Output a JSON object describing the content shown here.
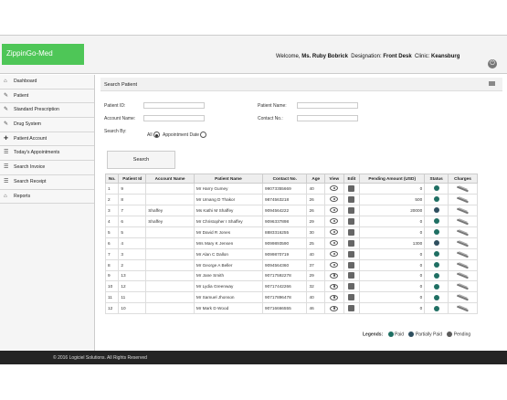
{
  "header": {
    "logo": "ZippinGo-Med",
    "welcome_label": "Welcome,",
    "user_name": "Ms. Ruby Bobrick",
    "designation_label": "Designation:",
    "designation": "Front Desk",
    "clinic_label": "Clinic:",
    "clinic": "Keansburg",
    "logout_icon": "power-icon"
  },
  "sidebar": {
    "items": [
      {
        "label": "Dashboard",
        "icon": "home-icon"
      },
      {
        "label": "Patient",
        "icon": "edit-icon"
      },
      {
        "label": "Standard Prescription",
        "icon": "edit-icon"
      },
      {
        "label": "Drug System",
        "icon": "edit-icon"
      },
      {
        "label": "Patient Account",
        "icon": "user-plus-icon"
      },
      {
        "label": "Today's Appointments",
        "icon": "list-icon"
      },
      {
        "label": "Search Invoice",
        "icon": "list-icon"
      },
      {
        "label": "Search Receipt",
        "icon": "list-icon"
      },
      {
        "label": "Reports",
        "icon": "home-icon"
      }
    ]
  },
  "search": {
    "panel_title": "Search Patient",
    "patient_id_label": "Patient ID:",
    "patient_id_value": "",
    "patient_name_label": "Patient Name:",
    "patient_name_value": "",
    "account_name_label": "Account Name:",
    "account_name_value": "",
    "contact_no_label": "Contact No.:",
    "contact_no_value": "",
    "search_by_label": "Search By:",
    "option_all": "All",
    "option_appointment": "Appointment Date",
    "selected": "All",
    "search_button": "Search"
  },
  "table": {
    "headers": [
      "No.",
      "Patient Id",
      "Account Name",
      "Patient Name",
      "Contact No.",
      "Age",
      "View",
      "Edit",
      "Pending Amount (USD)",
      "Status",
      "Charges"
    ],
    "rows": [
      {
        "no": "1",
        "pid": "9",
        "account": "",
        "name": "Mr Harry Gumey",
        "contact": "99073355669",
        "age": "40",
        "pending": "0",
        "status": "paid"
      },
      {
        "no": "2",
        "pid": "8",
        "account": "",
        "name": "Mr Umang D Thakor",
        "contact": "9874563218",
        "age": "26",
        "pending": "500",
        "status": "paid"
      },
      {
        "no": "3",
        "pid": "7",
        "account": "Shaffey",
        "name": "Ms Kathi M Shaffey",
        "contact": "9094564222",
        "age": "26",
        "pending": "20000",
        "status": "partially_paid"
      },
      {
        "no": "4",
        "pid": "6",
        "account": "Shaffey",
        "name": "Mr Christopher I Shaffey",
        "contact": "9096337898",
        "age": "29",
        "pending": "0",
        "status": "paid"
      },
      {
        "no": "5",
        "pid": "5",
        "account": "",
        "name": "Mr David R Jones",
        "contact": "8883316255",
        "age": "30",
        "pending": "0",
        "status": "paid"
      },
      {
        "no": "6",
        "pid": "4",
        "account": "",
        "name": "Mrs Mary K Jensen",
        "contact": "9099893590",
        "age": "25",
        "pending": "1300",
        "status": "partially_paid"
      },
      {
        "no": "7",
        "pid": "3",
        "account": "",
        "name": "Mr Alan C Dallon",
        "contact": "9099870719",
        "age": "40",
        "pending": "0",
        "status": "paid"
      },
      {
        "no": "8",
        "pid": "2",
        "account": "",
        "name": "Mr George A Beller",
        "contact": "9094564360",
        "age": "37",
        "pending": "0",
        "status": "paid"
      },
      {
        "no": "9",
        "pid": "13",
        "account": "",
        "name": "Mr Jane Smith",
        "contact": "90717592278",
        "age": "29",
        "pending": "0",
        "status": "paid"
      },
      {
        "no": "10",
        "pid": "12",
        "account": "",
        "name": "Mr Lydia Greenway",
        "contact": "90717442266",
        "age": "32",
        "pending": "0",
        "status": "paid"
      },
      {
        "no": "11",
        "pid": "11",
        "account": "",
        "name": "Mr Samuel Jhonson",
        "contact": "90717896478",
        "age": "40",
        "pending": "0",
        "status": "paid"
      },
      {
        "no": "12",
        "pid": "10",
        "account": "",
        "name": "Mr Mark D Wood",
        "contact": "90716666555",
        "age": "46",
        "pending": "0",
        "status": "paid"
      }
    ]
  },
  "legend": {
    "title": "Legends:",
    "paid": "Paid",
    "partially_paid": "Partially Paid",
    "pending": "Pending"
  },
  "footer": {
    "text": "© 2016 Logiciel Solutions. All Rights Reserved"
  },
  "colors": {
    "brand": "#4ec657",
    "footer_bg": "#242424",
    "paid": "#1f6f63",
    "partially_paid": "#2f4f5f",
    "pending": "#5a5a5a"
  }
}
